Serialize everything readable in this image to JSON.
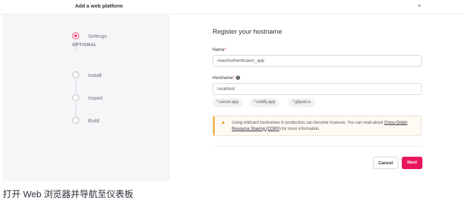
{
  "header": {
    "title": "Add a web platform",
    "close": "×"
  },
  "sidebar": {
    "optional_label": "OPTIONAL",
    "steps": [
      {
        "label": "Settings",
        "active": true
      },
      {
        "label": "Install",
        "active": false
      },
      {
        "label": "Import",
        "active": false
      },
      {
        "label": "Build",
        "active": false
      }
    ]
  },
  "main": {
    "title": "Register your hostname",
    "name_label": "Name",
    "name_value": "reactAuthenticaion_app",
    "hostname_label": "Hostname",
    "hostname_value": "localhost",
    "required_mark": "*",
    "info_glyph": "i",
    "chips": [
      "*.vercel.app",
      "*.netlify.app",
      "*.gitpod.io"
    ]
  },
  "alert": {
    "icon": "warning-icon",
    "text_before": "Using wildcard hostnames in production can become insecure. You can read about ",
    "link_text": "Cross-Origin Resource Sharing (CORS)",
    "text_after": " for more information."
  },
  "footer": {
    "cancel_label": "Cancel",
    "next_label": "Next"
  },
  "caption": "打开 Web 浏览器并导航至仪表板",
  "colors": {
    "accent": "#fd366e",
    "next_button": "#e8175d",
    "warning": "#f5a623"
  }
}
